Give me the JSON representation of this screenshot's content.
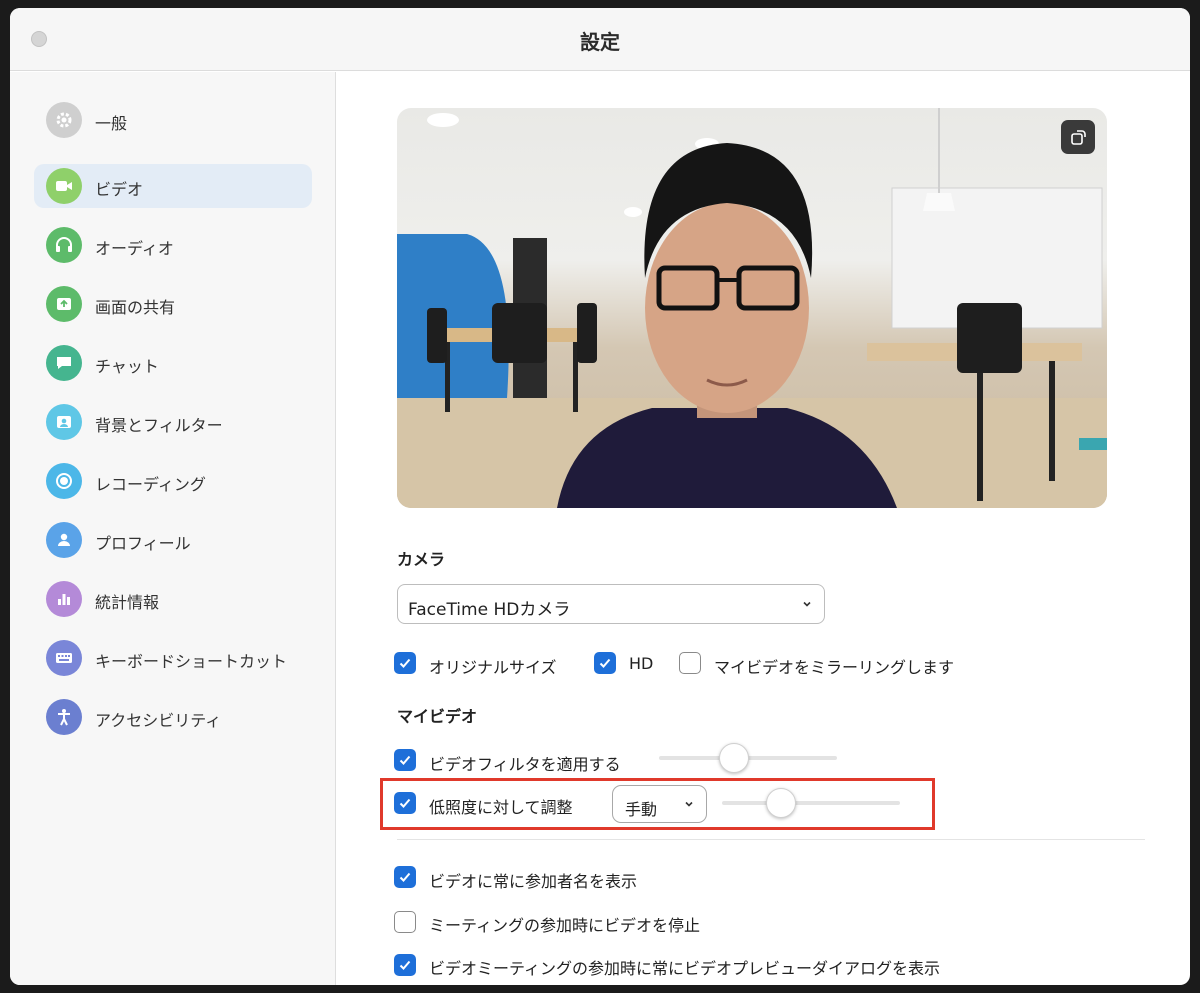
{
  "window": {
    "title": "設定"
  },
  "sidebar": {
    "items": [
      {
        "label": "一般",
        "icon": "gear-icon",
        "color": "#cfcfcf",
        "active": false
      },
      {
        "label": "ビデオ",
        "icon": "video-camera-icon",
        "color": "#8fd06a",
        "active": true
      },
      {
        "label": "オーディオ",
        "icon": "headphones-icon",
        "color": "#5dbb6a",
        "active": false
      },
      {
        "label": "画面の共有",
        "icon": "share-screen-icon",
        "color": "#5dbb6a",
        "active": false
      },
      {
        "label": "チャット",
        "icon": "chat-bubble-icon",
        "color": "#45b58f",
        "active": false
      },
      {
        "label": "背景とフィルター",
        "icon": "background-portrait-icon",
        "color": "#5fc7e6",
        "active": false
      },
      {
        "label": "レコーディング",
        "icon": "record-icon",
        "color": "#4cb7e8",
        "active": false
      },
      {
        "label": "プロフィール",
        "icon": "person-icon",
        "color": "#5aa3e8",
        "active": false
      },
      {
        "label": "統計情報",
        "icon": "bar-chart-icon",
        "color": "#b48ad8",
        "active": false
      },
      {
        "label": "キーボードショートカット",
        "icon": "keyboard-icon",
        "color": "#7a86d8",
        "active": false
      },
      {
        "label": "アクセシビリティ",
        "icon": "accessibility-icon",
        "color": "#6b7fd0",
        "active": false
      }
    ]
  },
  "camera": {
    "section_label": "カメラ",
    "selected_device": "FaceTime HDカメラ",
    "options": [
      {
        "label": "オリジナルサイズ",
        "checked": true
      },
      {
        "label": "HD",
        "checked": true
      },
      {
        "label": "マイビデオをミラーリングします",
        "checked": false
      }
    ]
  },
  "my_video": {
    "section_label": "マイビデオ",
    "filter": {
      "label": "ビデオフィルタを適用する",
      "checked": true,
      "slider_level": 0.42
    },
    "low_light": {
      "label": "低照度に対して調整",
      "checked": true,
      "mode": "手動",
      "slider_level": 0.33
    }
  },
  "more_options": [
    {
      "label": "ビデオに常に参加者名を表示",
      "checked": true
    },
    {
      "label": "ミーティングの参加時にビデオを停止",
      "checked": false
    },
    {
      "label": "ビデオミーティングの参加時に常にビデオプレビューダイアログを表示",
      "checked": true
    }
  ],
  "colors": {
    "accent": "#1e6fd9",
    "highlight_box": "#e0392b"
  }
}
